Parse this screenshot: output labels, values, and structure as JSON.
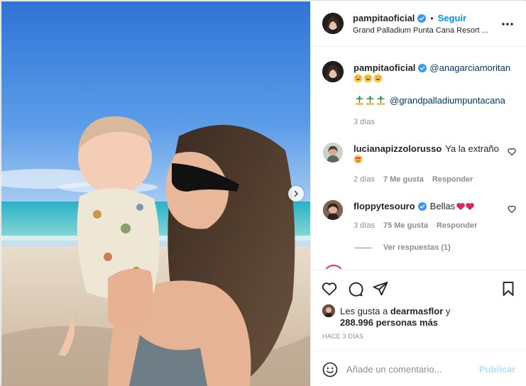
{
  "post": {
    "author": "pampitaoficial",
    "follow_label": "Seguir",
    "dot": "•",
    "location": "Grand Palladium Punta Cana Resort ..."
  },
  "caption": {
    "author": "pampitaoficial",
    "mention1": "@anagarciamoritan",
    "mention2": "@grandpalladiumpuntacana",
    "time": "3 días"
  },
  "comments": [
    {
      "user": "lucianapizzolorusso",
      "text": "Ya la extraño",
      "time": "2 días",
      "likes": "7 Me gusta",
      "reply": "Responder"
    },
    {
      "user": "floppytesouro",
      "text": "Bellas",
      "time": "3 días",
      "likes": "75 Me gusta",
      "reply": "Responder",
      "view_replies": "Ver respuestas (1)"
    }
  ],
  "likes": {
    "prefix": "Les gusta a",
    "user": "dearmasflor",
    "suffix": "y",
    "count": "288.996 personas más"
  },
  "posted_time": "HACE 3 DÍAS",
  "composer": {
    "placeholder": "Añade un comentario...",
    "publish_label": "Publicar"
  },
  "icons": {
    "verified": "verified-badge-icon",
    "more": "more-options-icon",
    "heart": "heart-icon",
    "comment": "comment-icon",
    "share": "share-icon",
    "save": "bookmark-icon",
    "emoji": "smiley-icon",
    "next": "chevron-right-icon"
  },
  "colors": {
    "accent": "#0095f6",
    "verified": "#3897f0",
    "mention": "#00376b",
    "muted": "#8e8e8e",
    "publish_disabled": "#b2dffc"
  }
}
